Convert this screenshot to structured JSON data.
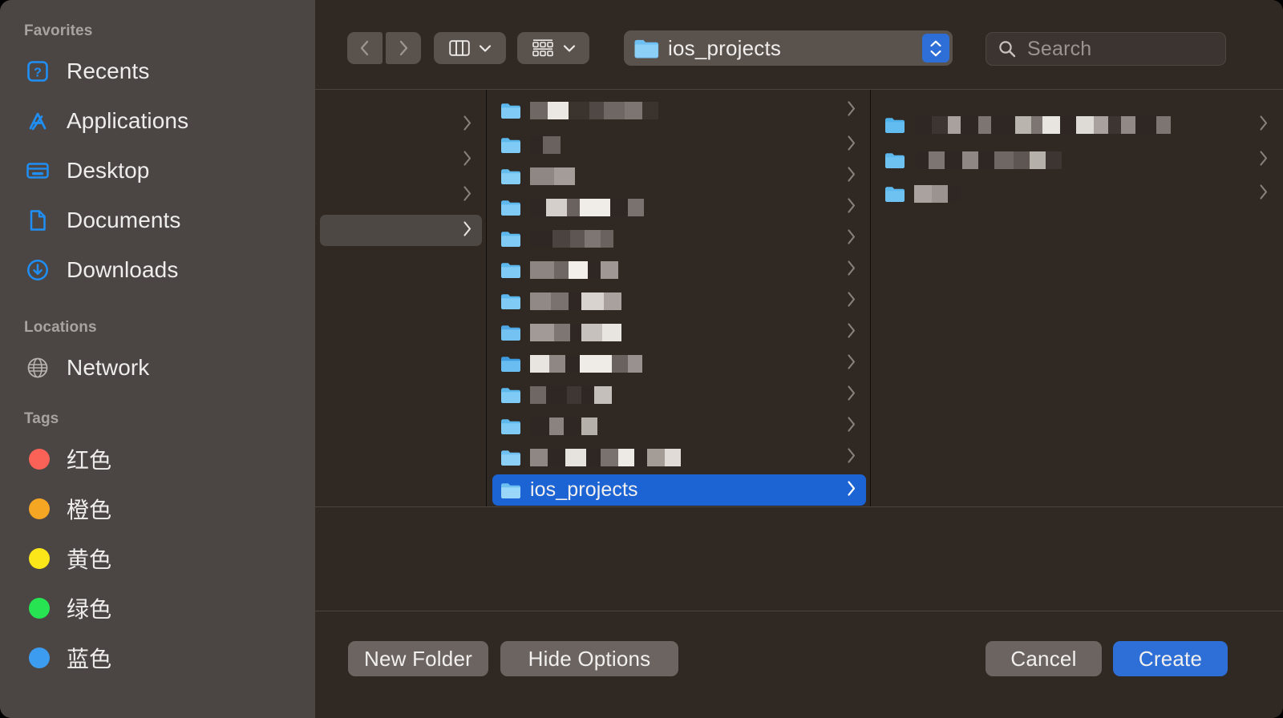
{
  "window": {
    "kind": "macos-save-dialog",
    "background_color": "#2F2823",
    "sidebar_color": "#4B4644"
  },
  "sidebar": {
    "sections": [
      {
        "header": "Favorites",
        "items": [
          {
            "label": "Recents",
            "icon": "recents-clock-icon",
            "color": "#1F8FF5"
          },
          {
            "label": "Applications",
            "icon": "applications-icon",
            "color": "#1F8FF5"
          },
          {
            "label": "Desktop",
            "icon": "desktop-icon",
            "color": "#1F8FF5"
          },
          {
            "label": "Documents",
            "icon": "documents-icon",
            "color": "#1F8FF5"
          },
          {
            "label": "Downloads",
            "icon": "downloads-icon",
            "color": "#1F8FF5"
          }
        ]
      },
      {
        "header": "Locations",
        "items": [
          {
            "label": "Network",
            "icon": "network-globe-icon",
            "color": "#B9B3B0"
          }
        ]
      },
      {
        "header": "Tags",
        "items": [
          {
            "label": "红色",
            "icon": "tag-dot-icon",
            "color": "#FA6258"
          },
          {
            "label": "橙色",
            "icon": "tag-dot-icon",
            "color": "#F5A623"
          },
          {
            "label": "黄色",
            "icon": "tag-dot-icon",
            "color": "#FBE719"
          },
          {
            "label": "绿色",
            "icon": "tag-dot-icon",
            "color": "#27E552"
          },
          {
            "label": "蓝色",
            "icon": "tag-dot-icon",
            "color": "#3C9CF0"
          }
        ]
      }
    ]
  },
  "toolbar": {
    "back_icon": "chevron-left-icon",
    "forward_icon": "chevron-right-icon",
    "view_mode_icon": "column-view-icon",
    "view_mode_chevron": "chevron-down-icon",
    "group_by_icon": "group-by-icon",
    "group_by_chevron": "chevron-down-icon",
    "path_popup": {
      "icon": "folder-icon",
      "label": "ios_projects",
      "stepper_icon": "up-down-stepper-icon"
    },
    "search": {
      "icon": "search-icon",
      "placeholder": "Search",
      "value": ""
    }
  },
  "browser": {
    "columns": [
      {
        "name": "column-1",
        "rows": [
          {
            "name": "",
            "redacted": true,
            "chevron": true,
            "selected": false,
            "icon": "none"
          },
          {
            "name": "",
            "redacted": true,
            "chevron": true,
            "selected": false,
            "icon": "none"
          },
          {
            "name": "",
            "redacted": true,
            "chevron": true,
            "selected": false,
            "icon": "none"
          },
          {
            "name": "",
            "redacted": true,
            "chevron": true,
            "selected": "gray",
            "icon": "none"
          }
        ]
      },
      {
        "name": "column-2",
        "rows": [
          {
            "name": "",
            "redacted": true,
            "chevron": true,
            "selected": false,
            "icon": "folder-icon"
          },
          {
            "name": "",
            "redacted": true,
            "chevron": true,
            "selected": false,
            "icon": "folder-icon"
          },
          {
            "name": "",
            "redacted": true,
            "chevron": true,
            "selected": false,
            "icon": "folder-icon"
          },
          {
            "name": "",
            "redacted": true,
            "chevron": true,
            "selected": false,
            "icon": "folder-icon"
          },
          {
            "name": "",
            "redacted": true,
            "chevron": true,
            "selected": false,
            "icon": "folder-icon"
          },
          {
            "name": "",
            "redacted": true,
            "chevron": true,
            "selected": false,
            "icon": "folder-icon"
          },
          {
            "name": "",
            "redacted": true,
            "chevron": true,
            "selected": false,
            "icon": "folder-icon"
          },
          {
            "name": "",
            "redacted": true,
            "chevron": true,
            "selected": false,
            "icon": "folder-icon"
          },
          {
            "name": "",
            "redacted": true,
            "chevron": true,
            "selected": false,
            "icon": "folder-icon"
          },
          {
            "name": "",
            "redacted": true,
            "chevron": true,
            "selected": false,
            "icon": "folder-icon"
          },
          {
            "name": "",
            "redacted": true,
            "chevron": true,
            "selected": false,
            "icon": "folder-icon"
          },
          {
            "name": "ios_projects",
            "redacted": false,
            "chevron": true,
            "selected": "blue",
            "icon": "folder-icon"
          }
        ]
      },
      {
        "name": "column-3",
        "rows": [
          {
            "name": "",
            "redacted": true,
            "chevron": true,
            "selected": false,
            "icon": "folder-icon"
          },
          {
            "name": "",
            "redacted": true,
            "chevron": true,
            "selected": false,
            "icon": "folder-icon"
          },
          {
            "name": "",
            "redacted": true,
            "chevron": true,
            "selected": false,
            "icon": "folder-icon"
          }
        ]
      }
    ]
  },
  "footer": {
    "new_folder_label": "New Folder",
    "hide_options_label": "Hide Options",
    "cancel_label": "Cancel",
    "create_label": "Create",
    "create_color": "#2D6FD6"
  }
}
